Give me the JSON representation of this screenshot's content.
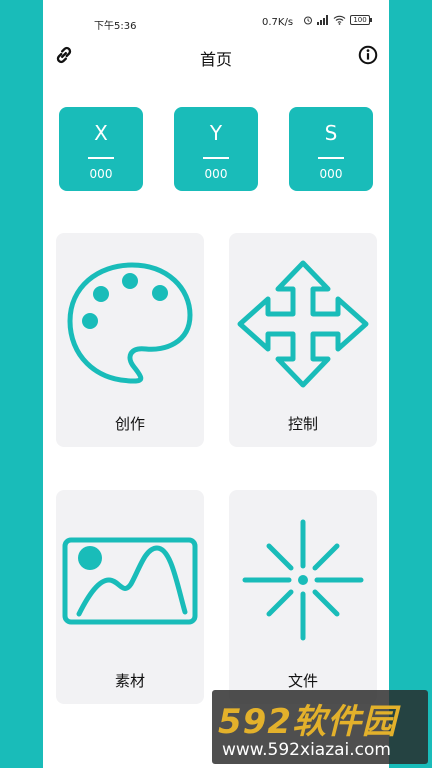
{
  "status_bar": {
    "time": "下午5:36",
    "network_speed": "0.7K/s",
    "battery": "100"
  },
  "header": {
    "title": "首页"
  },
  "coordinates": [
    {
      "label": "X",
      "value": "000"
    },
    {
      "label": "Y",
      "value": "000"
    },
    {
      "label": "S",
      "value": "000"
    }
  ],
  "cards": [
    {
      "label": "创作",
      "icon": "palette-icon"
    },
    {
      "label": "控制",
      "icon": "move-arrows-icon"
    },
    {
      "label": "素材",
      "icon": "image-icon"
    },
    {
      "label": "文件",
      "icon": "burst-icon"
    }
  ],
  "watermark": {
    "brand": "592软件园",
    "url": "www.592xiazai.com"
  },
  "colors": {
    "accent": "#19bcb9",
    "card_bg": "#f2f2f4"
  }
}
